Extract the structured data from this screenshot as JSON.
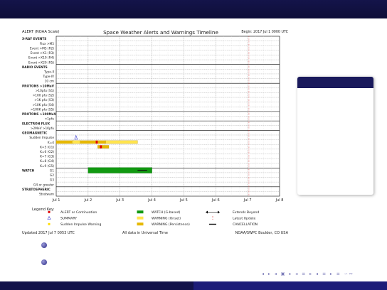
{
  "slide": {
    "nav_glyphs": "◂ ▸ ◂ ▣ ▸ ◂ ≡ ▸ ◂ ≡ ▸ ≡ ∽∾"
  },
  "chart_data": {
    "type": "timeline",
    "title": "Space Weather Alerts and Warnings Timeline",
    "begin_label": "Begin: 2017 Jul 1 0000 UTC",
    "corner_label": "ALERT (NOAA Scale)",
    "rows": [
      {
        "label": "X-RAY EVENTS",
        "header": true
      },
      {
        "label": "Flux >M5"
      },
      {
        "label": "Event >M5 (R2)"
      },
      {
        "label": "Event >X1 (R3)"
      },
      {
        "label": "Event >X10 (R4)"
      },
      {
        "label": "Event >X20 (R5)"
      },
      {
        "label": "RADIO EVENTS",
        "header": true
      },
      {
        "label": "Type-II"
      },
      {
        "label": "Type-IV"
      },
      {
        "label": "10 cm"
      },
      {
        "label": "PROTONS >10MeV",
        "header": true
      },
      {
        "label": ">10pfu (S1)"
      },
      {
        "label": ">100 pfu (S2)"
      },
      {
        "label": ">1K pfu (S3)"
      },
      {
        "label": ">10K pfu (S4)"
      },
      {
        "label": ">100K pfu (S5)"
      },
      {
        "label": "PROTONS >100MeV",
        "header": true
      },
      {
        "label": ">1pfu"
      },
      {
        "label": "ELECTRON FLUX",
        "header": true
      },
      {
        "label": ">2MeV >1Kpfu"
      },
      {
        "label": "GEOMAGNETIC",
        "header": true
      },
      {
        "label": "Sudden Impulse"
      },
      {
        "label": "K=4"
      },
      {
        "label": "K=5 (G1)"
      },
      {
        "label": "K=6 (G2)"
      },
      {
        "label": "K=7 (G3)"
      },
      {
        "label": "K=8 (G4)"
      },
      {
        "label": "K=9 (G5)"
      },
      {
        "label": "WATCH",
        "header": true,
        "sub": "G1"
      },
      {
        "label": "G2"
      },
      {
        "label": "G3"
      },
      {
        "label": "G4 or greater"
      },
      {
        "label": "STRATOSPHERIC",
        "header": true
      },
      {
        "label": "Stratwarn"
      }
    ],
    "x_ticks": [
      "Jul 1",
      "Jul 2",
      "Jul 3",
      "Jul 4",
      "Jul 5",
      "Jul 6",
      "Jul 7",
      "Jul 8"
    ],
    "x_range_days": [
      0,
      7
    ],
    "now_day": 6.04,
    "events": [
      {
        "row": "Sudden Impulse",
        "kind": "summary",
        "start": 0.62,
        "end": 0.62
      },
      {
        "row": "K=4",
        "kind": "warning-persist",
        "start": 0.0,
        "end": 0.55
      },
      {
        "row": "K=4",
        "kind": "warning-onset",
        "start": 0.5,
        "end": 0.75
      },
      {
        "row": "K=4",
        "kind": "warning-persist",
        "start": 0.75,
        "end": 1.55
      },
      {
        "row": "K=4",
        "kind": "warning-onset",
        "start": 1.55,
        "end": 2.55
      },
      {
        "row": "K=4",
        "kind": "alert",
        "start": 1.27,
        "end": 1.27
      },
      {
        "row": "K=5 (G1)",
        "kind": "warning-persist",
        "start": 1.3,
        "end": 1.65
      },
      {
        "row": "K=5 (G1)",
        "kind": "alert",
        "start": 1.4,
        "end": 1.4
      },
      {
        "row": "G1",
        "kind": "watch",
        "start": 1.0,
        "end": 3.0
      },
      {
        "row": "G1",
        "kind": "cancellation",
        "start": 2.55,
        "end": 2.85
      }
    ],
    "legend_title": "Legend Key:",
    "legend": [
      {
        "kind": "alert",
        "label": "ALERT or Continuation",
        "color": "#e00000"
      },
      {
        "kind": "summary",
        "label": "SUMMARY",
        "color": "#3333cc"
      },
      {
        "kind": "sudden",
        "label": "Sudden Impulse Warning",
        "color": "#ffdd00"
      },
      {
        "kind": "watch",
        "label": "WATCH (G-based)",
        "color": "#119911"
      },
      {
        "kind": "warning-onset",
        "label": "WARNING (Onset)",
        "color": "#ffe44d"
      },
      {
        "kind": "warning-persist",
        "label": "WARNING (Persistence)",
        "color": "#e6b800"
      },
      {
        "kind": "extends",
        "label": "Extends Beyond"
      },
      {
        "kind": "latest",
        "label": "Latest Update"
      },
      {
        "kind": "cancellation",
        "label": "CANCELLATION"
      }
    ],
    "footer_left": "Updated 2017 Jul  7 0053 UTC",
    "footer_mid": "All data in Universal Time",
    "footer_right": "NOAA/SWPC Boulder, CO USA"
  }
}
